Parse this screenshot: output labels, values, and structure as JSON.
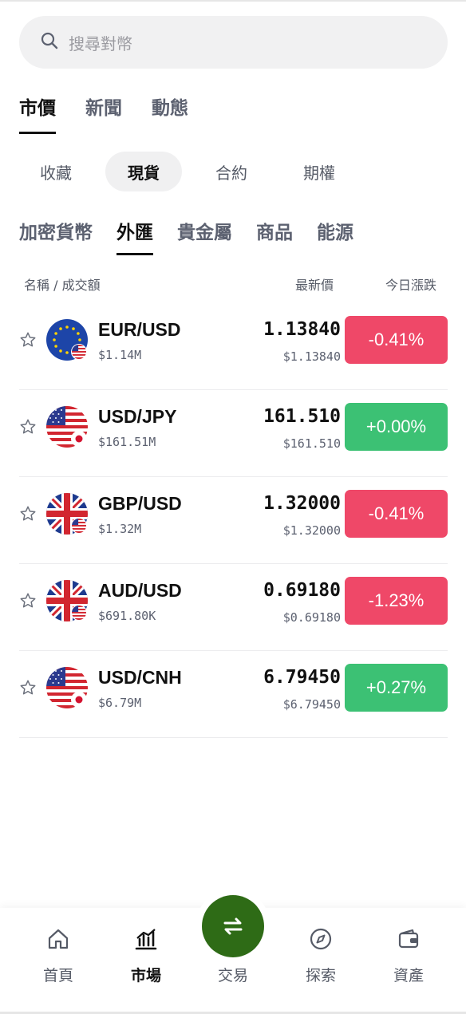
{
  "search": {
    "placeholder": "搜尋對幣"
  },
  "main_tabs": [
    "市價",
    "新聞",
    "動態"
  ],
  "segment_tabs": [
    "收藏",
    "現貨",
    "合約",
    "期權"
  ],
  "category_tabs": [
    "加密貨幣",
    "外匯",
    "貴金屬",
    "商品",
    "能源"
  ],
  "columns": {
    "name": "名稱 / 成交額",
    "price": "最新價",
    "change": "今日漲跌"
  },
  "colors": {
    "negative": "#ef4868",
    "positive": "#3cc174",
    "fab": "#2e6b16"
  },
  "rows": [
    {
      "pair": "EUR/USD",
      "volume": "$1.14M",
      "price": "1.13840",
      "sub_price": "$1.13840",
      "change": "-0.41%",
      "direction": "down",
      "flag": "eu-flag-icon",
      "subflag": "us-flag-icon"
    },
    {
      "pair": "USD/JPY",
      "volume": "$161.51M",
      "price": "161.510",
      "sub_price": "$161.510",
      "change": "+0.00%",
      "direction": "up",
      "flag": "us-flag-icon",
      "subflag": "jp-flag-icon"
    },
    {
      "pair": "GBP/USD",
      "volume": "$1.32M",
      "price": "1.32000",
      "sub_price": "$1.32000",
      "change": "-0.41%",
      "direction": "down",
      "flag": "uk-flag-icon",
      "subflag": "us-flag-icon"
    },
    {
      "pair": "AUD/USD",
      "volume": "$691.80K",
      "price": "0.69180",
      "sub_price": "$0.69180",
      "change": "-1.23%",
      "direction": "down",
      "flag": "uk-flag-icon",
      "subflag": "us-flag-icon"
    },
    {
      "pair": "USD/CNH",
      "volume": "$6.79M",
      "price": "6.79450",
      "sub_price": "$6.79450",
      "change": "+0.27%",
      "direction": "up",
      "flag": "us-flag-icon",
      "subflag": "cn-flag-icon"
    }
  ],
  "bottom_nav": {
    "home": "首頁",
    "market": "市場",
    "trade": "交易",
    "explore": "探索",
    "assets": "資產"
  }
}
